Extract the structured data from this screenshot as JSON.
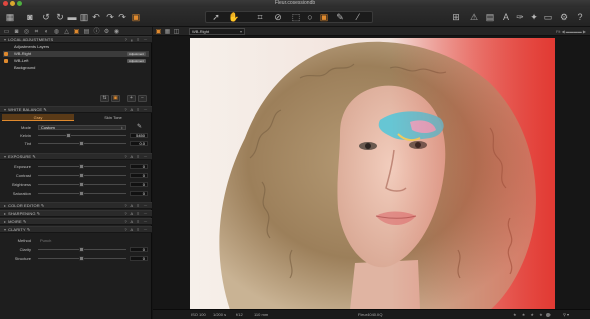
{
  "window": {
    "title": "Fleur.cosessiondb"
  },
  "toolbar": {
    "icons": [
      "library-icon",
      "camera-icon",
      "rotate-left-icon",
      "rotate-right-icon",
      "folder-icon",
      "trash-icon",
      "undo-icon",
      "redo-left-icon",
      "redo-right-icon",
      "workspace-icon",
      "cursor-tool-icon",
      "hand-tool-icon",
      "crop-tool-icon",
      "straighten-icon",
      "keystone-icon",
      "circle-brush-icon",
      "layer-brush-icon",
      "picker-icon",
      "grid-view-icon",
      "warning-icon",
      "text-icon",
      "pick-icon",
      "print-icon",
      "settings-icon",
      "help-icon"
    ]
  },
  "left_panel": {
    "local_adjustments": {
      "header": "LOCAL ADJUSTMENTS",
      "layers": [
        {
          "label": "Adjustments Layers",
          "checked": false,
          "selected": false,
          "badge": ""
        },
        {
          "label": "WB-Right",
          "checked": true,
          "selected": true,
          "badge": "Adjustment"
        },
        {
          "label": "WB-Left",
          "checked": true,
          "selected": false,
          "badge": "Adjustment"
        },
        {
          "label": "Background",
          "checked": false,
          "selected": false,
          "badge": ""
        }
      ]
    },
    "white_balance": {
      "header": "WHITE BALANCE",
      "tabs": [
        "Gray",
        "Skin Tone"
      ],
      "active_tab": "Gray",
      "mode_label": "Mode",
      "mode_value": "Custom",
      "kelvin_label": "Kelvin",
      "kelvin_value": "5450",
      "tint_label": "Tint",
      "tint_value": "0.0"
    },
    "exposure": {
      "header": "EXPOSURE",
      "rows": [
        {
          "label": "Exposure",
          "value": "0"
        },
        {
          "label": "Contrast",
          "value": "0"
        },
        {
          "label": "Brightness",
          "value": "0"
        },
        {
          "label": "Saturation",
          "value": "0"
        }
      ]
    },
    "collapsed_sections": [
      "COLOR EDITOR",
      "SHARPENING",
      "MOIRE"
    ],
    "clarity": {
      "header": "CLARITY",
      "method_label": "Method",
      "method_value": "Punch",
      "rows": [
        {
          "label": "Clarity",
          "value": "0"
        },
        {
          "label": "Structure",
          "value": "0"
        }
      ]
    }
  },
  "viewer": {
    "variant": "WB-Right",
    "zoom": "Fit",
    "status": {
      "iso": "ISO 100",
      "shutter": "1/200 s",
      "aperture": "f/12",
      "focal": "110 mm",
      "filename": "Fleur4040.IIQ",
      "stars": "★ ★ ★ ★ ★"
    }
  },
  "colors": {
    "accent": "#e08a2e",
    "panel": "#1e1e1e",
    "red_tint": "#e63b35"
  }
}
